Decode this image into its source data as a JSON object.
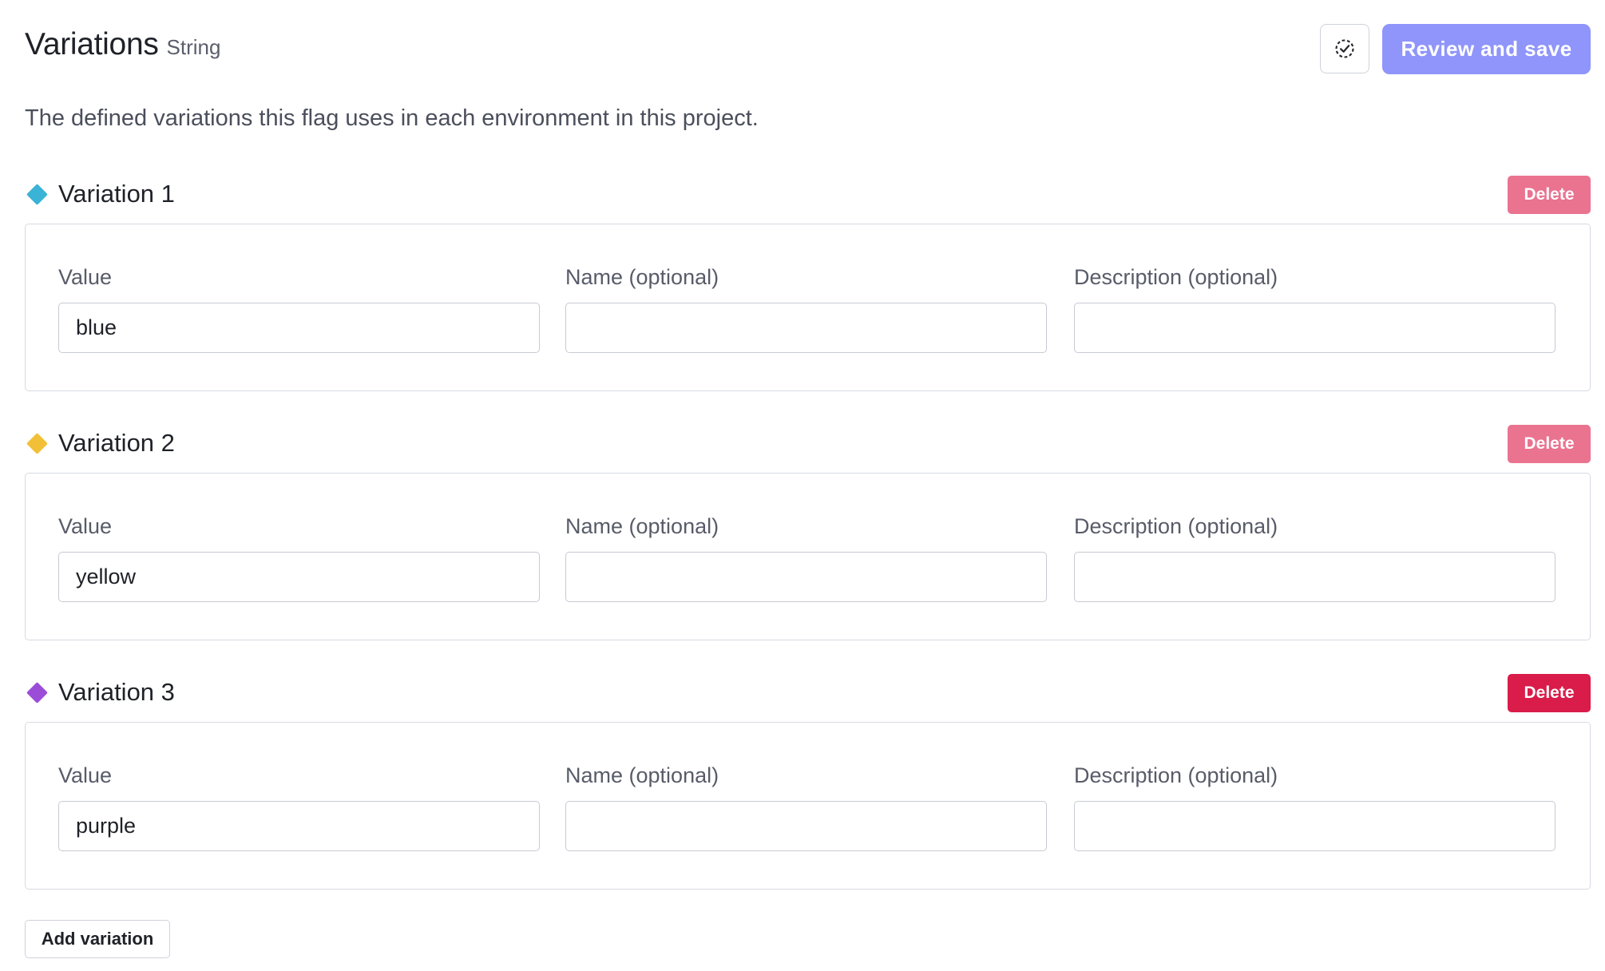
{
  "header": {
    "title": "Variations",
    "type_label": "String",
    "review_label": "Review and save",
    "check_icon": "dashed-circle-check-icon"
  },
  "description": "The defined variations this flag uses in each environment in this project.",
  "variations": [
    {
      "title": "Variation 1",
      "color": "#3ab3d6",
      "delete_label": "Delete",
      "delete_color": "#ea7390",
      "fields": {
        "value_label": "Value",
        "value": "blue",
        "name_label": "Name (optional)",
        "name_value": "",
        "description_label": "Description (optional)",
        "description_value": ""
      }
    },
    {
      "title": "Variation 2",
      "color": "#f2c037",
      "delete_label": "Delete",
      "delete_color": "#ea7390",
      "fields": {
        "value_label": "Value",
        "value": "yellow",
        "name_label": "Name (optional)",
        "name_value": "",
        "description_label": "Description (optional)",
        "description_value": ""
      }
    },
    {
      "title": "Variation 3",
      "color": "#9b4dd8",
      "delete_label": "Delete",
      "delete_color": "#d91c4a",
      "fields": {
        "value_label": "Value",
        "value": "purple",
        "name_label": "Name (optional)",
        "name_value": "",
        "description_label": "Description (optional)",
        "description_value": ""
      }
    }
  ],
  "add_variation_label": "Add variation"
}
